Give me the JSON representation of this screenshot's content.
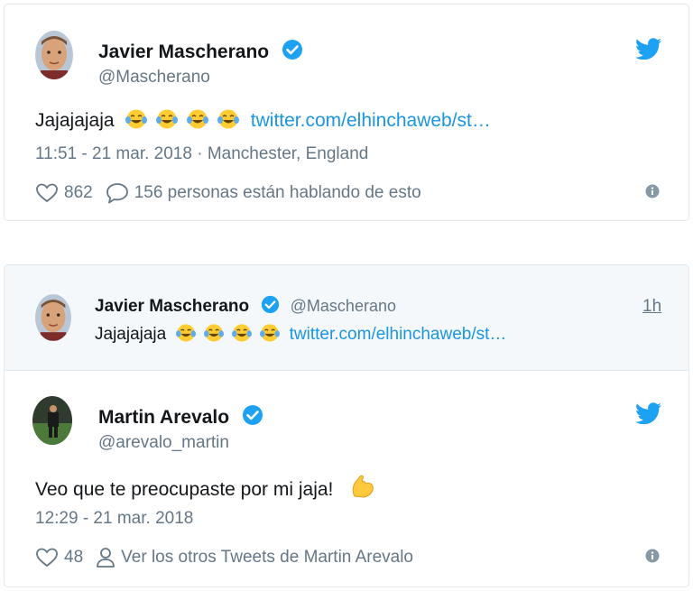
{
  "tweet1": {
    "name": "Javier Mascherano",
    "handle": "@Mascherano",
    "text": "Jajajajaja",
    "link": "twitter.com/elhinchaweb/st…",
    "meta": "11:51 - 21 mar. 2018 · Manchester, England",
    "likes": "862",
    "replies": "156 personas están hablando de esto"
  },
  "tweet2": {
    "quoted": {
      "name": "Javier Mascherano",
      "handle": "@Mascherano",
      "time": "1h",
      "text": "Jajajajaja",
      "link": "twitter.com/elhinchaweb/st…"
    },
    "name": "Martin Arevalo",
    "handle": "@arevalo_martin",
    "text": "Veo que te preocupaste por mi jaja!",
    "meta": "12:29 - 21 mar. 2018",
    "likes": "48",
    "profile_link": "Ver los otros Tweets de Martin Arevalo"
  },
  "colors": {
    "accent": "#1da1f2",
    "link": "#1b95e0",
    "muted": "#657786",
    "quoted_bg": "#f5f8fa"
  },
  "icons": [
    "verified-badge-icon",
    "twitter-bird-icon",
    "heart-icon",
    "reply-bubble-icon",
    "info-icon",
    "person-icon",
    "tears-of-joy-emoji",
    "flexed-biceps-emoji"
  ]
}
